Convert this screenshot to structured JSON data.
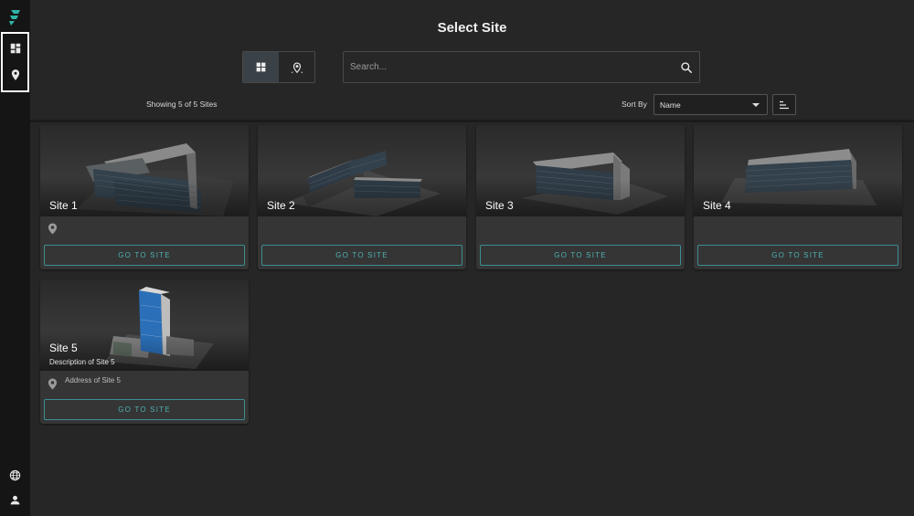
{
  "app": {
    "title": "Select Site",
    "accent_color": "#2fb3a6",
    "logo_icon": "brand-logo-icon"
  },
  "sidebar": {
    "nav": [
      {
        "icon": "dashboard-icon"
      },
      {
        "icon": "map-pin-icon"
      }
    ],
    "bottom": [
      {
        "icon": "globe-icon"
      },
      {
        "icon": "user-icon"
      }
    ]
  },
  "toolbar": {
    "view_modes": [
      {
        "icon": "grid-view-icon",
        "active": true
      },
      {
        "icon": "map-view-icon",
        "active": false
      }
    ],
    "search": {
      "placeholder": "Search...",
      "value": "",
      "icon": "search-icon"
    },
    "showing_text": "Showing 5 of 5 Sites",
    "sort_label": "Sort By",
    "sort_value": "Name",
    "sort_direction_icon": "sort-lines-icon"
  },
  "sites": [
    {
      "name": "Site 1",
      "description": "",
      "address": "",
      "button": "GO TO SITE"
    },
    {
      "name": "Site 2",
      "description": "",
      "address": "",
      "button": "GO TO SITE"
    },
    {
      "name": "Site 3",
      "description": "",
      "address": "",
      "button": "GO TO SITE"
    },
    {
      "name": "Site 4",
      "description": "",
      "address": "",
      "button": "GO TO SITE"
    },
    {
      "name": "Site 5",
      "description": "Description of Site 5",
      "address": "Address of Site 5",
      "button": "GO TO SITE"
    }
  ]
}
